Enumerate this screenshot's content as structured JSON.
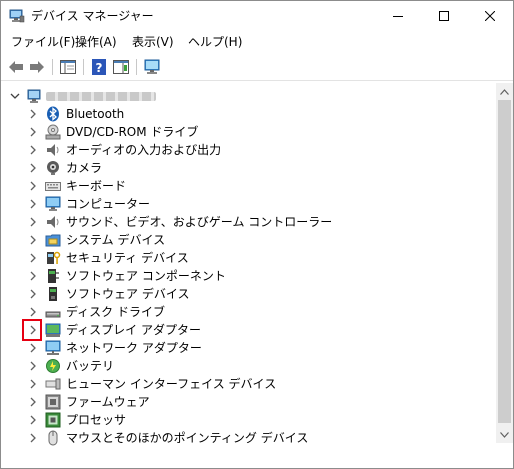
{
  "window": {
    "title": "デバイス マネージャー"
  },
  "menu": {
    "items": [
      {
        "label": "ファイル(F)"
      },
      {
        "label": "操作(A)"
      },
      {
        "label": "表示(V)"
      },
      {
        "label": "ヘルプ(H)"
      }
    ]
  },
  "tree": {
    "root_expanded": true,
    "categories": [
      {
        "label": "Bluetooth",
        "icon": "bluetooth-icon"
      },
      {
        "label": "DVD/CD-ROM ドライブ",
        "icon": "dvd-drive-icon"
      },
      {
        "label": "オーディオの入力および出力",
        "icon": "speaker-icon"
      },
      {
        "label": "カメラ",
        "icon": "camera-icon"
      },
      {
        "label": "キーボード",
        "icon": "keyboard-icon"
      },
      {
        "label": "コンピューター",
        "icon": "monitor-icon"
      },
      {
        "label": "サウンド、ビデオ、およびゲーム コントローラー",
        "icon": "speaker-icon"
      },
      {
        "label": "システム デバイス",
        "icon": "folder-chip-icon"
      },
      {
        "label": "セキュリティ デバイス",
        "icon": "security-key-icon"
      },
      {
        "label": "ソフトウェア コンポーネント",
        "icon": "component-icon"
      },
      {
        "label": "ソフトウェア デバイス",
        "icon": "software-device-icon"
      },
      {
        "label": "ディスク ドライブ",
        "icon": "disk-drive-icon"
      },
      {
        "label": "ディスプレイ アダプター",
        "icon": "display-adapter-icon"
      },
      {
        "label": "ネットワーク アダプター",
        "icon": "network-adapter-icon"
      },
      {
        "label": "バッテリ",
        "icon": "battery-icon"
      },
      {
        "label": "ヒューマン インターフェイス デバイス",
        "icon": "hid-icon"
      },
      {
        "label": "ファームウェア",
        "icon": "firmware-icon"
      },
      {
        "label": "プロセッサ",
        "icon": "processor-icon"
      },
      {
        "label": "マウスとそのほかのポインティング デバイス",
        "icon": "mouse-icon"
      }
    ]
  },
  "colors": {
    "highlight_box": "#e60012",
    "accent_blue": "#0078d7"
  }
}
